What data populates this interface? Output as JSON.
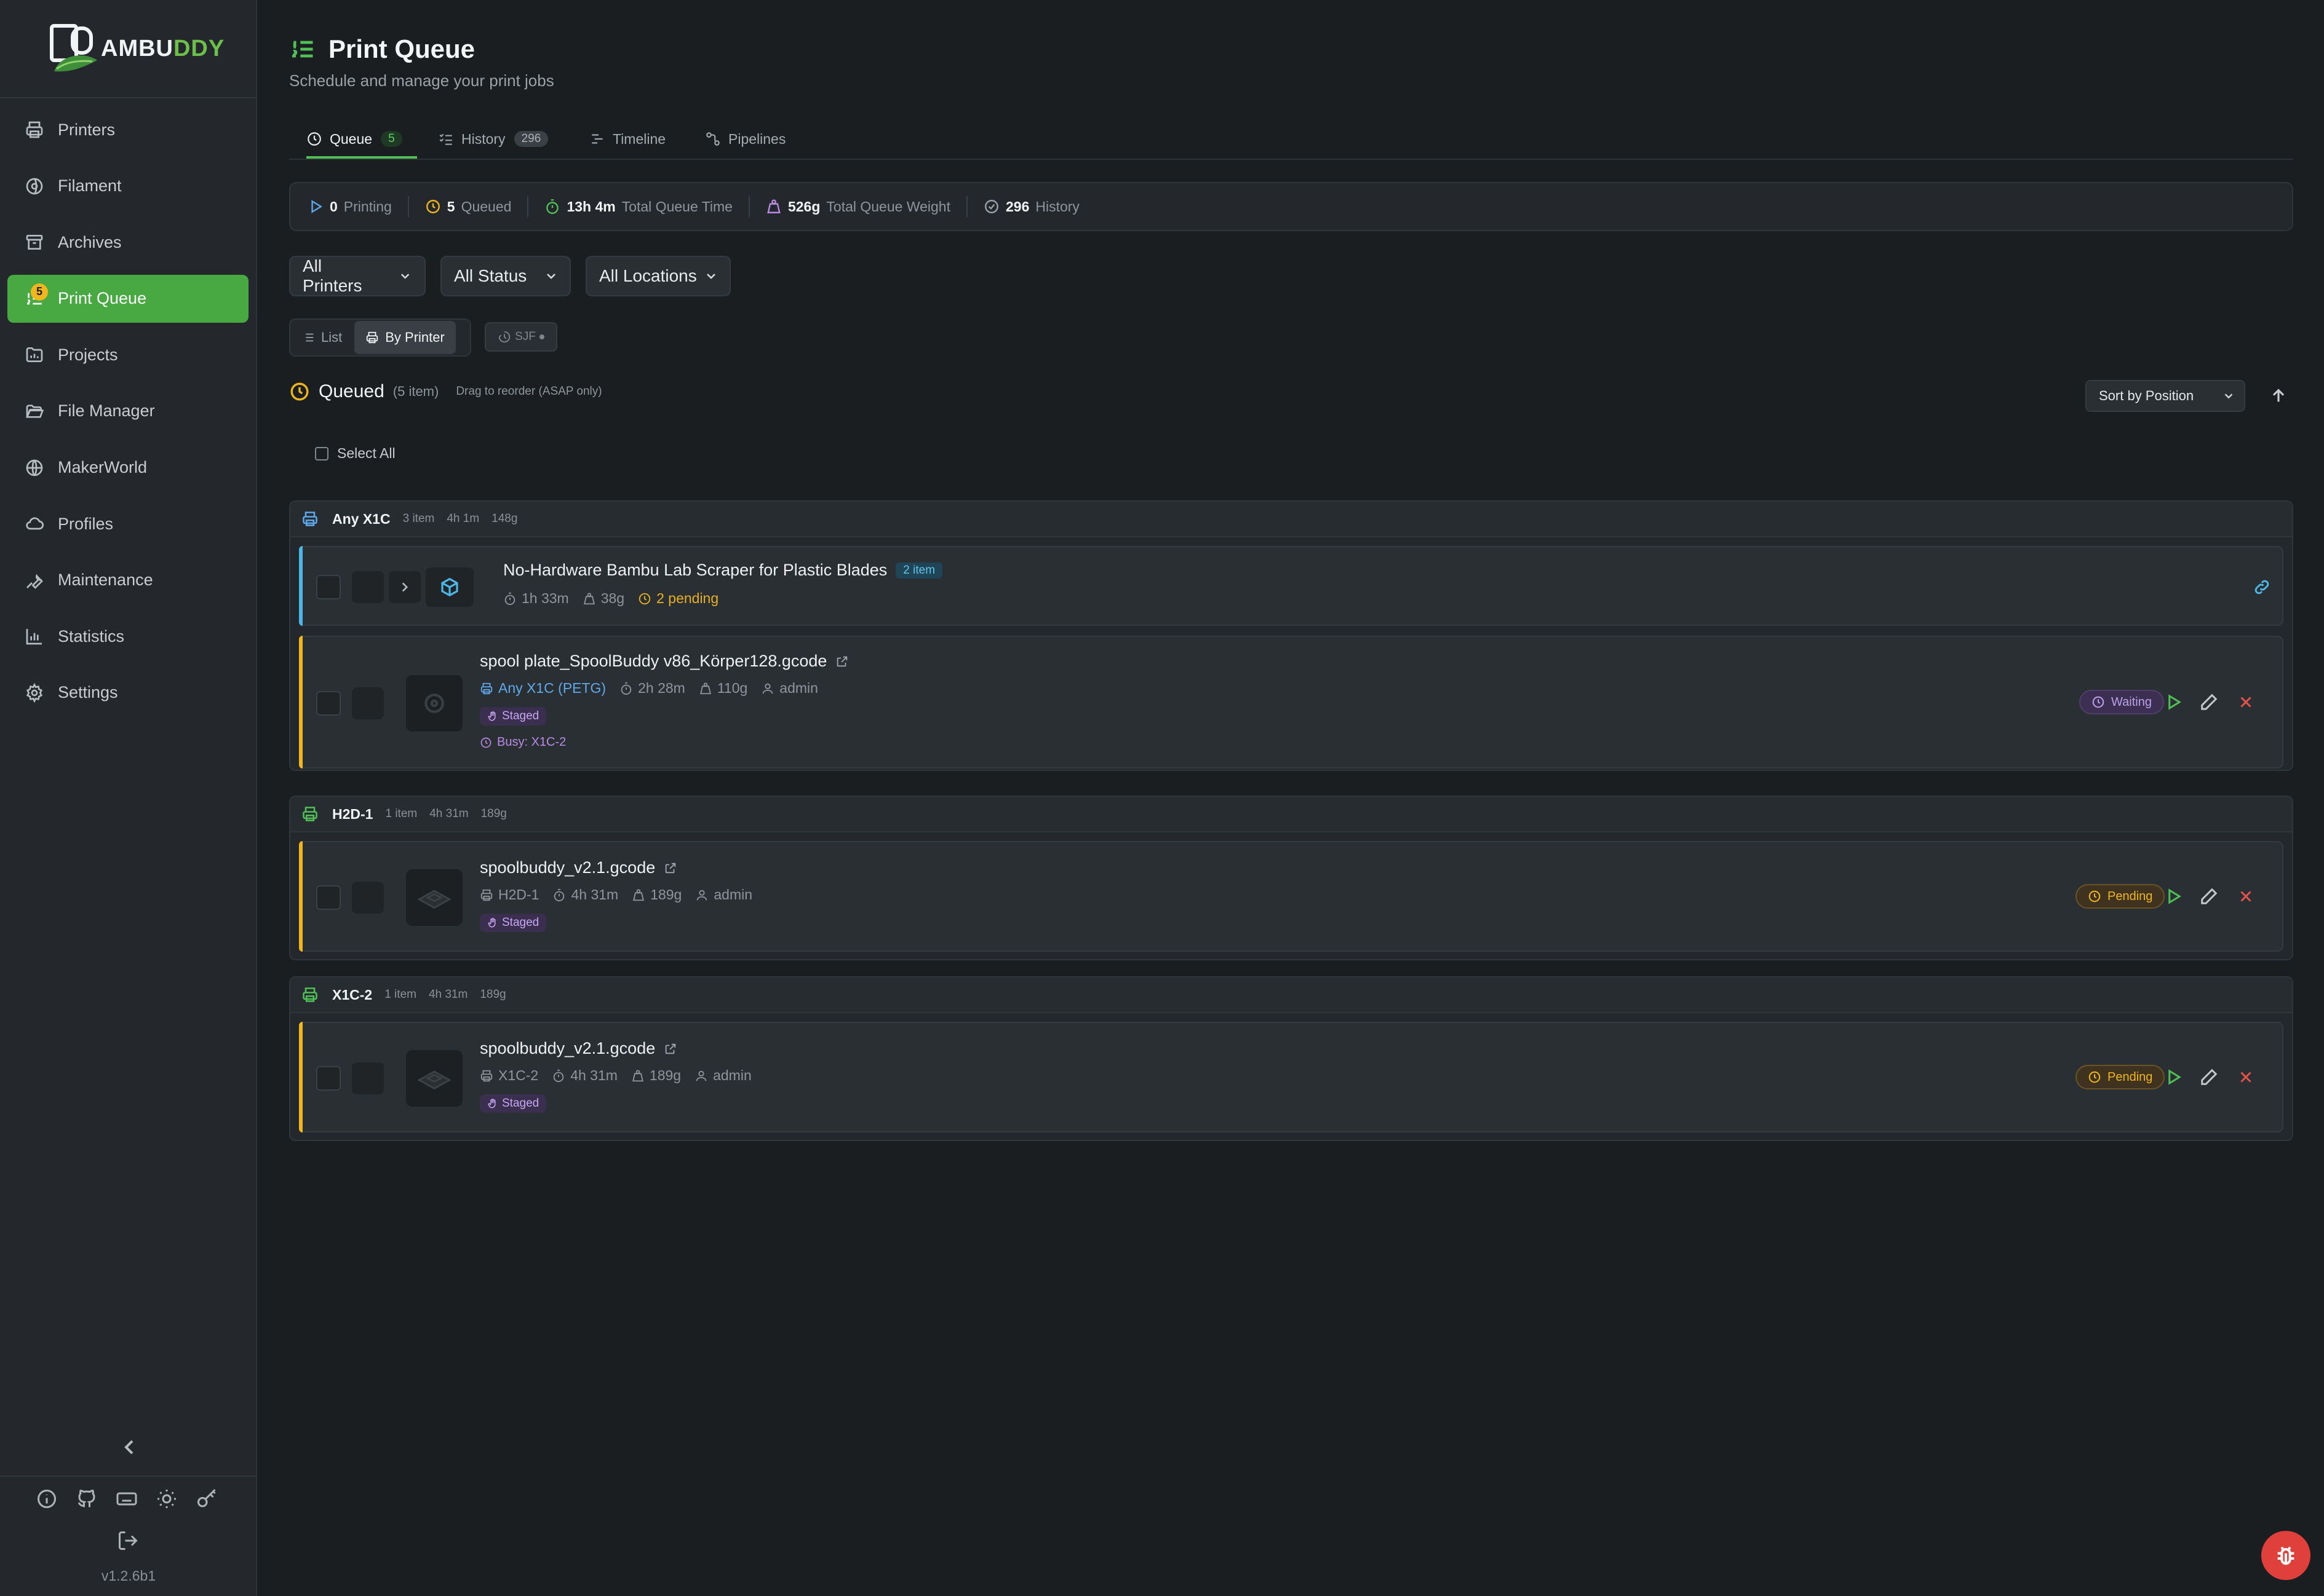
{
  "app": {
    "logo_left": "AMBU",
    "logo_right": "DDY",
    "version": "v1.2.6b1"
  },
  "colors": {
    "accent": "#48a942",
    "queued": "#f0b61e",
    "pending": "#f0b61e",
    "waiting": "#bda0ea",
    "staged": "#c9a6f3",
    "bug_button": "#e0403b"
  },
  "sidebar": {
    "items": [
      {
        "label": "Printers",
        "icon": "printer-icon"
      },
      {
        "label": "Filament",
        "icon": "spool-icon"
      },
      {
        "label": "Archives",
        "icon": "archive-icon"
      },
      {
        "label": "Print Queue",
        "icon": "list-ordered-icon",
        "badge": "5",
        "active": true
      },
      {
        "label": "Projects",
        "icon": "folder-chart-icon"
      },
      {
        "label": "File Manager",
        "icon": "folder-open-icon"
      },
      {
        "label": "MakerWorld",
        "icon": "globe-icon"
      },
      {
        "label": "Profiles",
        "icon": "cloud-icon"
      },
      {
        "label": "Maintenance",
        "icon": "wrench-icon"
      },
      {
        "label": "Statistics",
        "icon": "bar-chart-icon"
      },
      {
        "label": "Settings",
        "icon": "gear-icon"
      }
    ],
    "footer_icons": [
      "info-icon",
      "github-icon",
      "keyboard-icon",
      "sun-icon",
      "key-icon"
    ]
  },
  "header": {
    "title": "Print Queue",
    "subtitle": "Schedule and manage your print jobs"
  },
  "tabs": [
    {
      "label": "Queue",
      "count": "5",
      "active": true
    },
    {
      "label": "History",
      "count": "296"
    },
    {
      "label": "Timeline"
    },
    {
      "label": "Pipelines"
    }
  ],
  "stats": {
    "printing": {
      "value": "0",
      "label": "Printing"
    },
    "queued": {
      "value": "5",
      "label": "Queued"
    },
    "time": {
      "value": "13h 4m",
      "label": "Total Queue Time"
    },
    "weight": {
      "value": "526g",
      "label": "Total Queue Weight"
    },
    "history": {
      "value": "296",
      "label": "History"
    }
  },
  "filters": {
    "printers": "All Printers",
    "status": "All Status",
    "locations": "All Locations"
  },
  "view": {
    "list": "List",
    "by_printer": "By Printer",
    "sjf": "SJF"
  },
  "queued_section": {
    "title": "Queued",
    "count": "(5 item)",
    "hint": "Drag to reorder (ASAP only)",
    "sort": "Sort by Position",
    "select_all": "Select All"
  },
  "groups": [
    {
      "name": "Any X1C",
      "items": "3 item",
      "time": "4h 1m",
      "weight": "148g",
      "jobs": [
        {
          "title": "No-Hardware Bambu Lab Scraper for Plastic Blades",
          "badge": "2 item",
          "time": "1h 33m",
          "weight": "38g",
          "pending": "2 pending"
        },
        {
          "title": "spool plate_SpoolBuddy v86_Körper128.gcode",
          "printer": "Any X1C (PETG)",
          "time": "2h 28m",
          "weight": "110g",
          "user": "admin",
          "staged": "Staged",
          "busy": "Busy: X1C-2",
          "status": "Waiting"
        }
      ]
    },
    {
      "name": "H2D-1",
      "items": "1 item",
      "time": "4h 31m",
      "weight": "189g",
      "jobs": [
        {
          "title": "spoolbuddy_v2.1.gcode",
          "printer": "H2D-1",
          "time": "4h 31m",
          "weight": "189g",
          "user": "admin",
          "staged": "Staged",
          "status": "Pending"
        }
      ]
    },
    {
      "name": "X1C-2",
      "items": "1 item",
      "time": "4h 31m",
      "weight": "189g",
      "jobs": [
        {
          "title": "spoolbuddy_v2.1.gcode",
          "printer": "X1C-2",
          "time": "4h 31m",
          "weight": "189g",
          "user": "admin",
          "staged": "Staged",
          "status": "Pending"
        }
      ]
    }
  ]
}
